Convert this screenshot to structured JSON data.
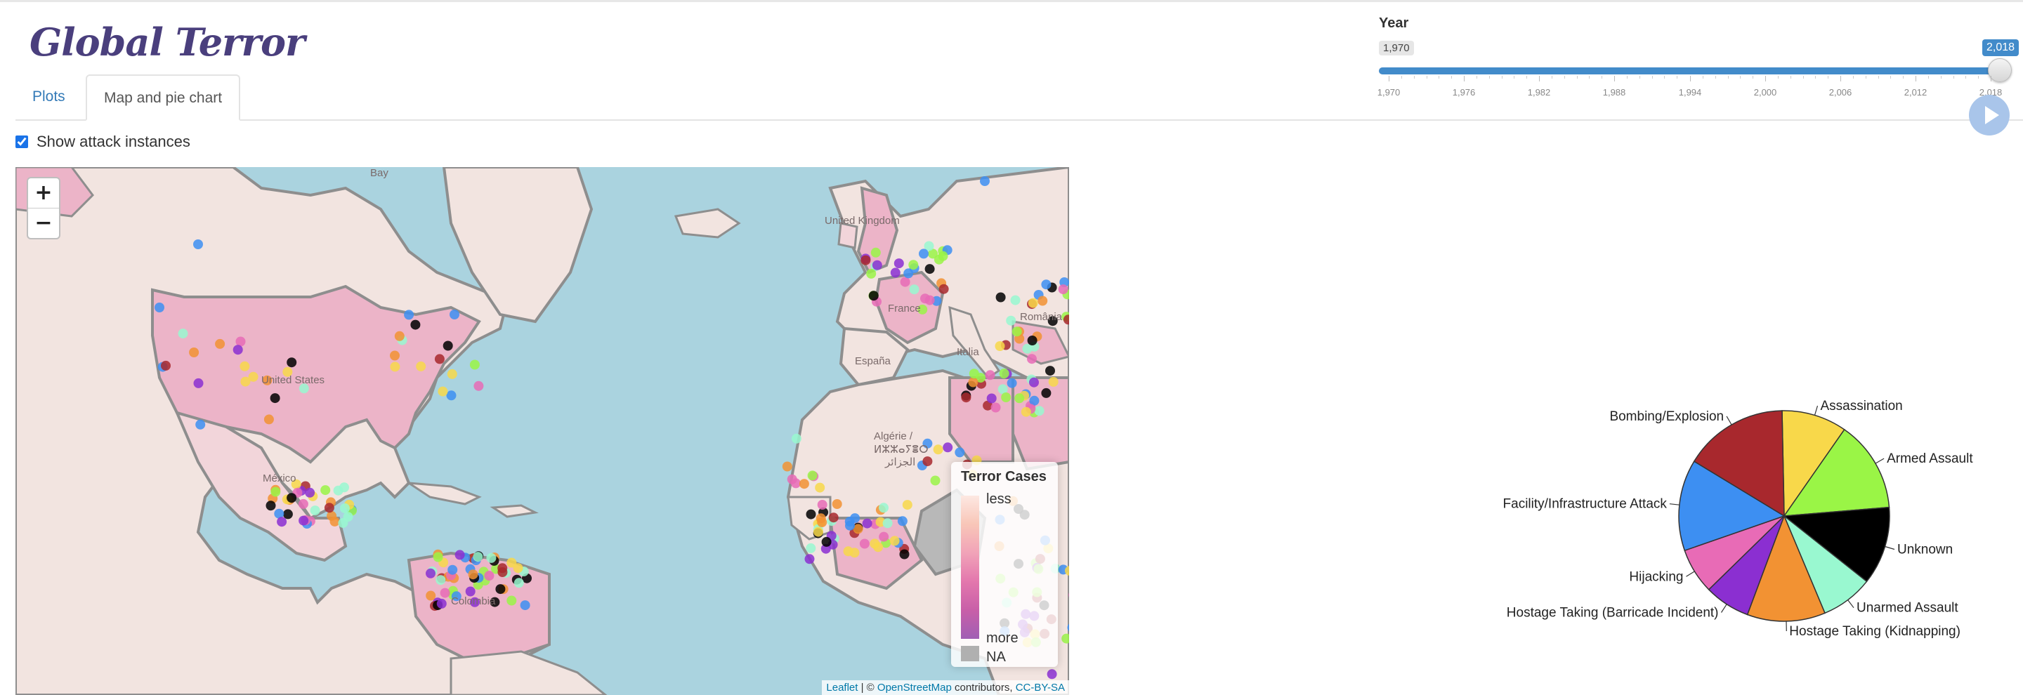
{
  "app": {
    "title": "Global Terror"
  },
  "tabs": [
    {
      "label": "Plots",
      "active": false
    },
    {
      "label": "Map and pie chart",
      "active": true
    }
  ],
  "controls": {
    "show_attacks_label": "Show attack instances",
    "show_attacks_checked": true,
    "year": {
      "label": "Year",
      "min_badge": "1,970",
      "max_badge": "2,018",
      "min": 1970,
      "max": 2018,
      "selected_min": 1970,
      "selected_max": 2018,
      "ticks": [
        "1,970",
        "1,976",
        "1,982",
        "1,988",
        "1,994",
        "2,000",
        "2,006",
        "2,012",
        "2,018"
      ]
    },
    "play_icon": "play-icon"
  },
  "map": {
    "zoom_in": "+",
    "zoom_out": "−",
    "place_labels": {
      "united_states": "United States",
      "mexico": "México",
      "united_kingdom": "United Kingdom",
      "france": "France",
      "espana": "España",
      "algerie": "Algérie /",
      "algerie_2": "ⵍⵣⵣⴰⵢⴻⵔ",
      "algerie_3": "الجزائر",
      "colombia": "Colombia",
      "romania": "România",
      "italia": "Italia",
      "baie": "Bay"
    },
    "legend": {
      "title": "Terror Cases",
      "less": "less",
      "more": "more",
      "na": "NA"
    },
    "attribution": {
      "leaflet": "Leaflet",
      "sep": " | © ",
      "osm": "OpenStreetMap",
      "contributors": " contributors, ",
      "license": "CC-BY-SA"
    },
    "colors": {
      "water": "#aad3df",
      "land": "#f2e4e0",
      "choropleth": "#ecb4c8",
      "border": "#8e8e8e"
    }
  },
  "chart_data": {
    "type": "pie",
    "title": "",
    "slices": [
      {
        "label": "Assassination",
        "value": 10,
        "color": "#f8d84a"
      },
      {
        "label": "Armed Assault",
        "value": 14,
        "color": "#9af546"
      },
      {
        "label": "Unknown",
        "value": 12,
        "color": "#000000"
      },
      {
        "label": "Unarmed Assault",
        "value": 8,
        "color": "#99f8d0"
      },
      {
        "label": "Hostage Taking (Kidnapping)",
        "value": 12,
        "color": "#f29233"
      },
      {
        "label": "Hostage Taking (Barricade Incident)",
        "value": 7,
        "color": "#8b2fd1"
      },
      {
        "label": "Hijacking",
        "value": 7,
        "color": "#e86bb6"
      },
      {
        "label": "Facility/Infrastructure Attack",
        "value": 14,
        "color": "#3d8ff2"
      },
      {
        "label": "Bombing/Explosion",
        "value": 16,
        "color": "#a8282d"
      }
    ]
  }
}
